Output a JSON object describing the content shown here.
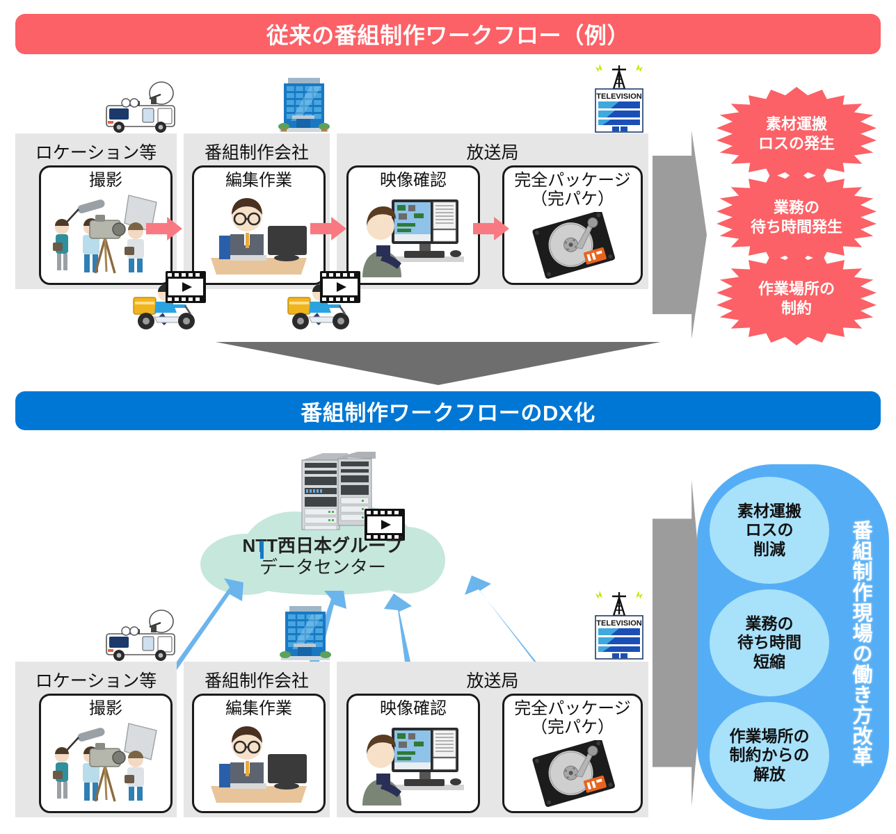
{
  "top_section": {
    "banner": "従来の番組制作ワークフロー（例）",
    "groups": [
      {
        "title": "ロケーション等",
        "cards": [
          {
            "title": "撮影",
            "icon": "film-crew-shooting-icon"
          }
        ],
        "icon": "satellite-broadcast-van-icon"
      },
      {
        "title": "番組制作会社",
        "cards": [
          {
            "title": "編集作業",
            "icon": "editor-at-desk-icon"
          }
        ],
        "icon": "office-building-icon"
      },
      {
        "title": "放送局",
        "cards": [
          {
            "title": "映像確認",
            "icon": "video-check-operator-icon"
          },
          {
            "title": "完全パッケージ\n（完パケ）",
            "icon": "hard-disk-drive-icon"
          }
        ],
        "icon": "television-station-icon"
      }
    ],
    "transport_icons": [
      "delivery-motorcycle-icon",
      "film-strip-icon"
    ],
    "problems": [
      "素材運搬\nロスの発生",
      "業務の\n待ち時間発生",
      "作業場所の\n制約"
    ]
  },
  "transition": {
    "icon": "down-arrow-icon"
  },
  "bottom_section": {
    "banner": "番組制作ワークフローのDX化",
    "cloud": {
      "line1": "NTT西日本グループ",
      "line2": "データセンター",
      "icons": [
        "server-rack-icon",
        "film-strip-icon"
      ]
    },
    "groups": [
      {
        "title": "ロケーション等",
        "cards": [
          {
            "title": "撮影",
            "icon": "film-crew-shooting-icon"
          }
        ],
        "icon": "satellite-broadcast-van-icon"
      },
      {
        "title": "番組制作会社",
        "cards": [
          {
            "title": "編集作業",
            "icon": "editor-at-desk-icon"
          }
        ],
        "icon": "office-building-icon"
      },
      {
        "title": "放送局",
        "cards": [
          {
            "title": "映像確認",
            "icon": "video-check-operator-icon"
          },
          {
            "title": "完全パッケージ\n（完パケ）",
            "icon": "hard-disk-drive-icon"
          }
        ],
        "icon": "television-station-icon"
      }
    ],
    "benefits": [
      "素材運搬\nロスの\n削減",
      "業務の\n待ち時間\n短縮",
      "作業場所の\n制約からの\n解放"
    ],
    "slogan": "番組制作現場の働き方改革"
  },
  "tv_building_label": "TELEVISION",
  "colors": {
    "red_banner": "#FB6166",
    "blue_banner": "#0077D4",
    "cloud_green": "#C6E7DC",
    "panel_blue": "#55AEF5",
    "circle_blue": "#A8E1FA",
    "grey_arrow": "#9C9C9C",
    "pink_arrow": "#F87981",
    "blue_arrow": "#6BB5EC",
    "section_grey": "#E6E6E6"
  }
}
